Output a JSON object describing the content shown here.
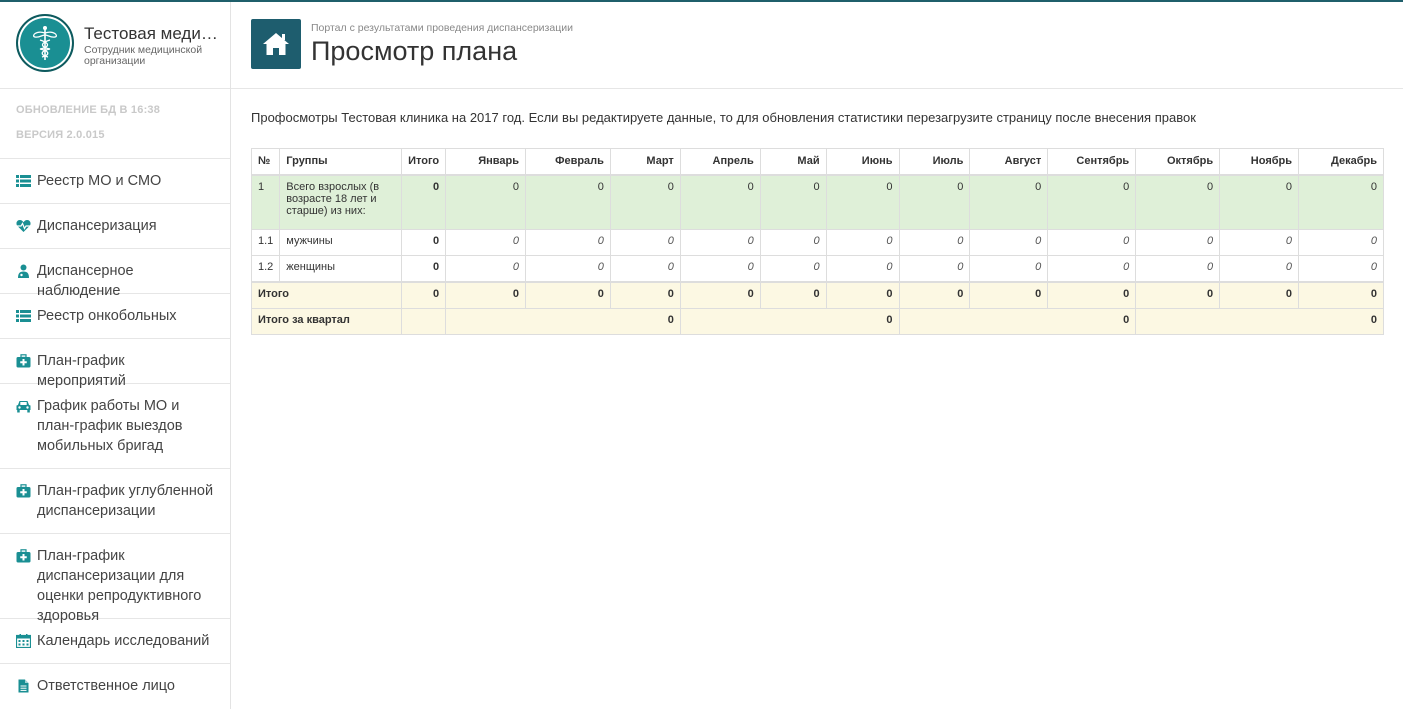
{
  "brand": {
    "title": "Тестовая медицинская организация",
    "subtitle": "Сотрудник медицинской организации"
  },
  "meta": {
    "update": "ОБНОВЛЕНИЕ БД В 16:38",
    "version": "ВЕРСИЯ 2.0.015"
  },
  "nav": [
    {
      "label": "Реестр МО и СМО",
      "icon": "list-icon"
    },
    {
      "label": "Диспансеризация",
      "icon": "heartbeat-icon"
    },
    {
      "label": "Диспансерное наблюдение",
      "icon": "user-md-icon"
    },
    {
      "label": "Реестр онкобольных",
      "icon": "list-icon"
    },
    {
      "label": "План-график мероприятий",
      "icon": "medkit-icon"
    },
    {
      "label": "График работы МО и план-график выездов мобильных бригад",
      "icon": "car-icon"
    },
    {
      "label": "План-график углубленной диспансеризации",
      "icon": "medkit-icon"
    },
    {
      "label": "План-график диспансеризации для оценки репродуктивного здоровья",
      "icon": "medkit-icon"
    },
    {
      "label": "Календарь исследований",
      "icon": "calendar-icon"
    },
    {
      "label": "Ответственное лицо",
      "icon": "file-icon"
    }
  ],
  "header": {
    "breadcrumb": "Портал с результатами проведения диспансеризации",
    "title": "Просмотр плана",
    "home_icon": "home-icon"
  },
  "info_text": "Профосмотры Тестовая клиника на 2017 год. Если вы редактируете данные, то для обновления статистики перезагрузите страницу после внесения правок",
  "table": {
    "headers": [
      "№",
      "Группы",
      "Итого",
      "Январь",
      "Февраль",
      "Март",
      "Апрель",
      "Май",
      "Июнь",
      "Июль",
      "Август",
      "Сентябрь",
      "Октябрь",
      "Ноябрь",
      "Декабрь"
    ],
    "rows": [
      {
        "num": "1",
        "group": "Всего взрослых (в возрасте 18 лет и старше) из них:",
        "total": "0",
        "months": [
          "0",
          "0",
          "0",
          "0",
          "0",
          "0",
          "0",
          "0",
          "0",
          "0",
          "0",
          "0"
        ]
      },
      {
        "num": "1.1",
        "group": "мужчины",
        "total": "0",
        "months": [
          "0",
          "0",
          "0",
          "0",
          "0",
          "0",
          "0",
          "0",
          "0",
          "0",
          "0",
          "0"
        ]
      },
      {
        "num": "1.2",
        "group": "женщины",
        "total": "0",
        "months": [
          "0",
          "0",
          "0",
          "0",
          "0",
          "0",
          "0",
          "0",
          "0",
          "0",
          "0",
          "0"
        ]
      }
    ],
    "total_row": {
      "label": "Итого",
      "total": "0",
      "months": [
        "0",
        "0",
        "0",
        "0",
        "0",
        "0",
        "0",
        "0",
        "0",
        "0",
        "0",
        "0"
      ]
    },
    "quarter_row": {
      "label": "Итого за квартал",
      "total": "",
      "quarters": [
        "0",
        "0",
        "0",
        "0"
      ]
    }
  },
  "colors": {
    "accent": "#1e5d6e",
    "logo": "#1a8f93",
    "icon": "#1a8f93",
    "row_green": "#dff0d8",
    "row_yellow": "#fcf8e3"
  }
}
